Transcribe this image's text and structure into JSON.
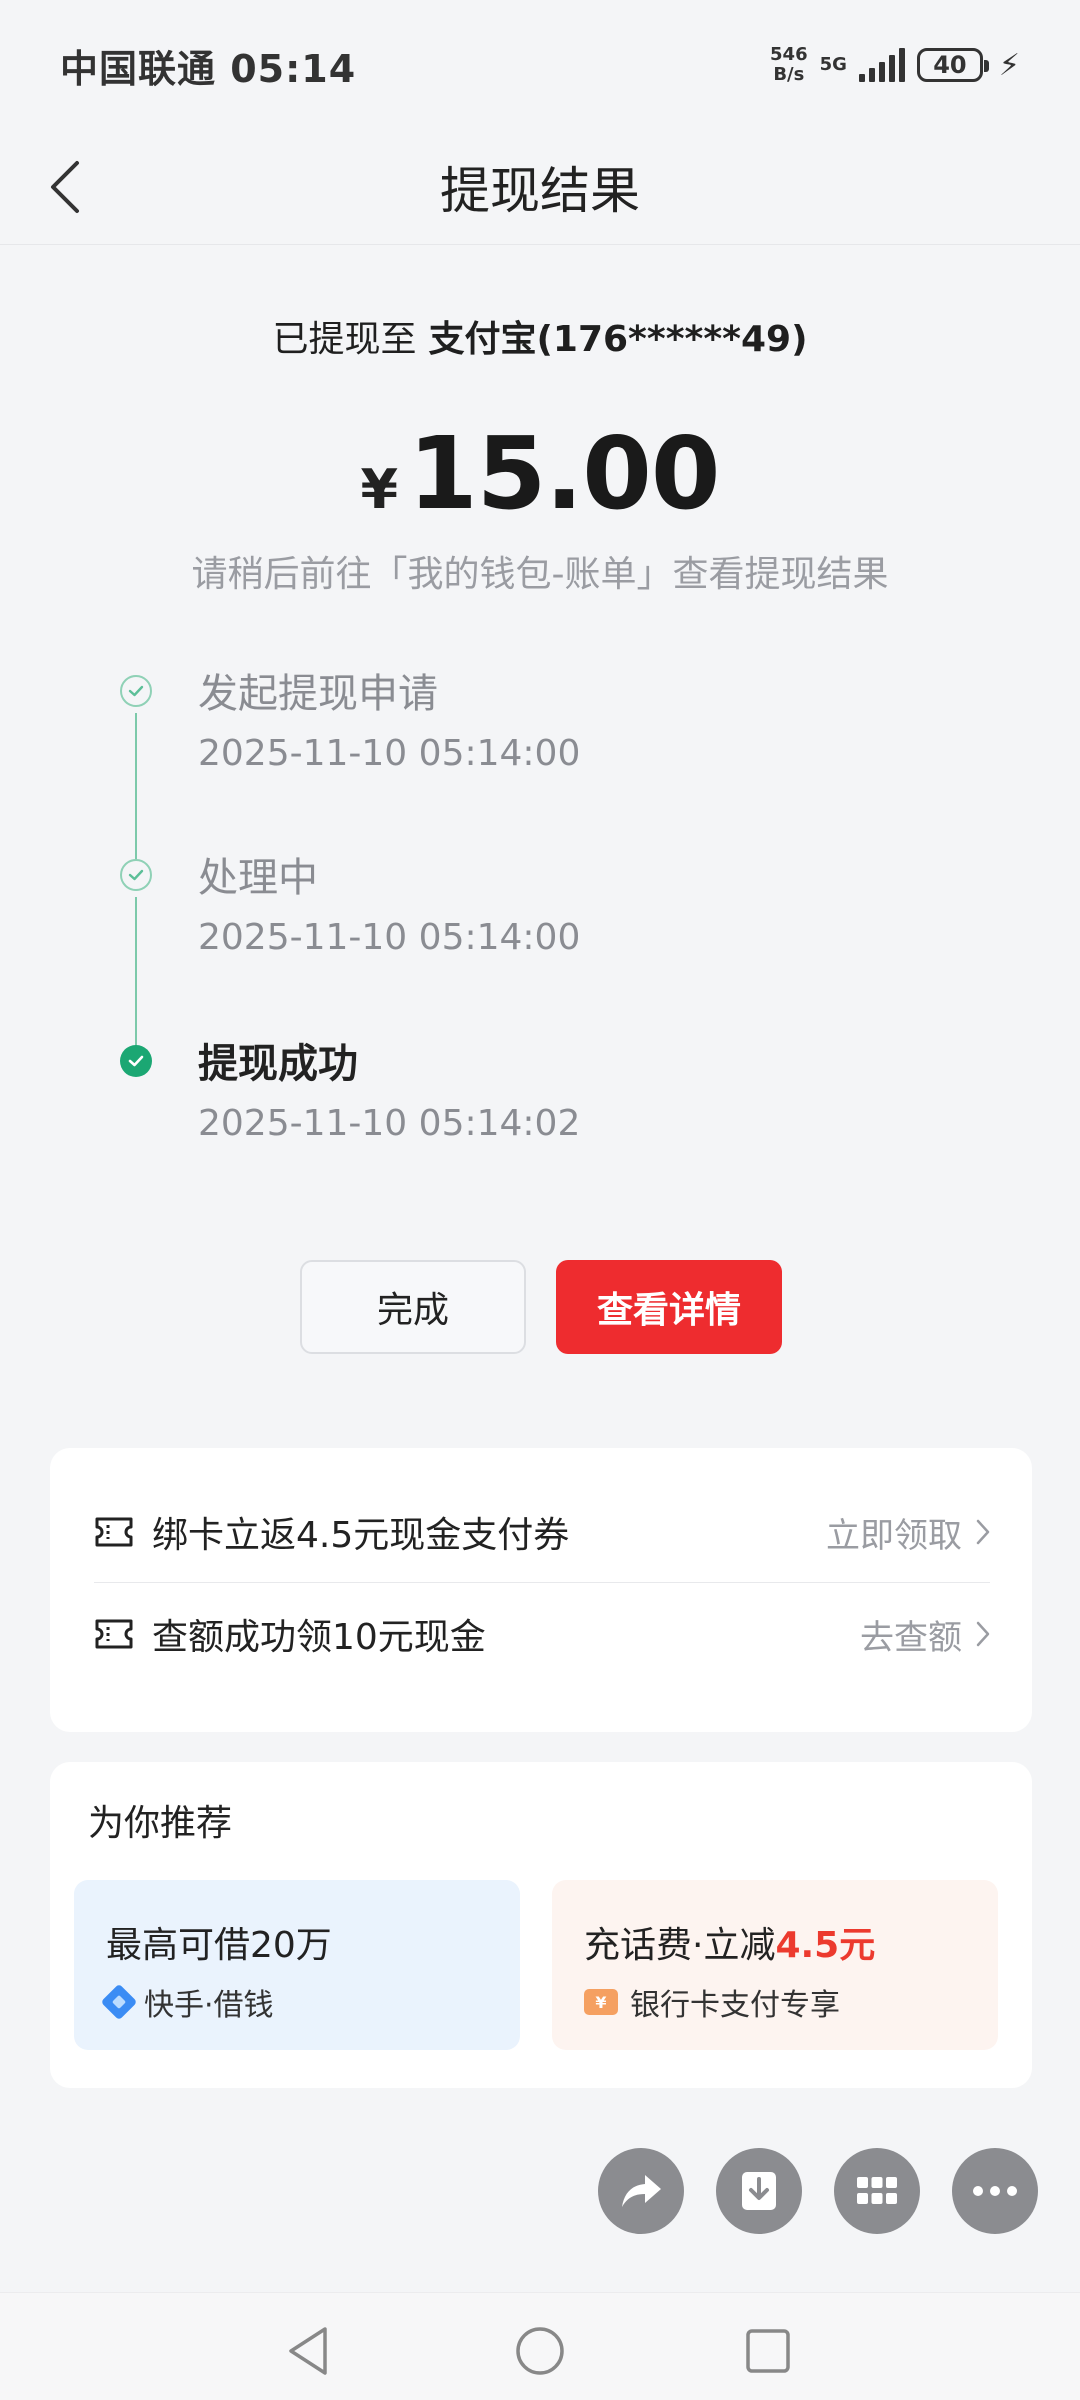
{
  "status_bar": {
    "carrier_time": "中国联通 05:14",
    "net_speed_value": "546",
    "net_speed_unit": "B/s",
    "network": "5G",
    "battery": "40"
  },
  "header": {
    "title": "提现结果"
  },
  "result": {
    "dest_label": "已提现至",
    "dest_account": "支付宝(176******49)",
    "currency": "¥",
    "amount": "15.00",
    "hint": "请稍后前往「我的钱包-账单」查看提现结果"
  },
  "timeline": [
    {
      "title": "发起提现申请",
      "time": "2025-11-10 05:14:00",
      "state": "done"
    },
    {
      "title": "处理中",
      "time": "2025-11-10 05:14:00",
      "state": "done"
    },
    {
      "title": "提现成功",
      "time": "2025-11-10 05:14:02",
      "state": "final"
    }
  ],
  "actions": {
    "done_label": "完成",
    "detail_label": "查看详情"
  },
  "promotions": [
    {
      "text": "绑卡立返4.5元现金支付券",
      "action": "立即领取"
    },
    {
      "text": "查额成功领10元现金",
      "action": "去查额"
    }
  ],
  "recommend": {
    "title": "为你推荐",
    "tiles": [
      {
        "title": "最高可借20万",
        "sub": "快手·借钱"
      },
      {
        "title_prefix": "充话费·立减",
        "title_highlight": "4.5元",
        "sub": "银行卡支付专享",
        "badge": "¥"
      }
    ]
  },
  "colors": {
    "accent_red": "#ee2c2f",
    "success_green": "#1ba773",
    "highlight_red": "#ec3a2e"
  }
}
